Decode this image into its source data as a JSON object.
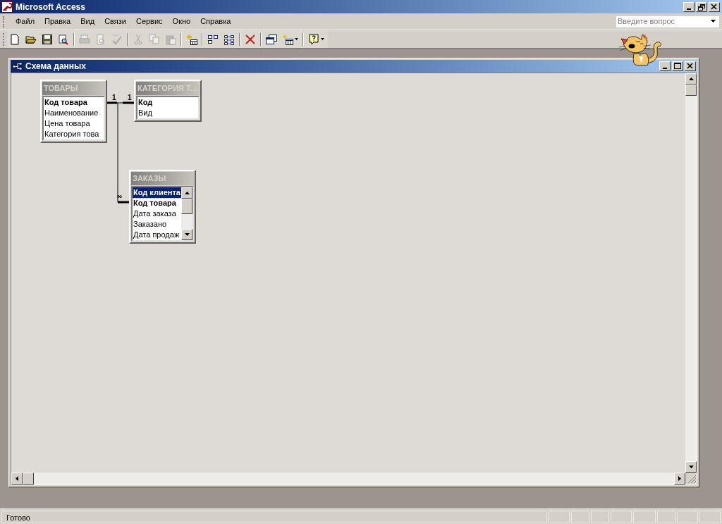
{
  "window": {
    "title": "Microsoft Access"
  },
  "menu": [
    "Файл",
    "Правка",
    "Вид",
    "Связи",
    "Сервис",
    "Окно",
    "Справка"
  ],
  "help_search": {
    "placeholder": "Введите вопрос"
  },
  "toolbar": [
    {
      "kind": "new",
      "disabled": false
    },
    {
      "kind": "open",
      "disabled": false
    },
    {
      "kind": "save",
      "disabled": false
    },
    {
      "kind": "search",
      "disabled": false
    },
    {
      "kind": "separator"
    },
    {
      "kind": "print",
      "disabled": true
    },
    {
      "kind": "preview",
      "disabled": true
    },
    {
      "kind": "spelling",
      "disabled": true
    },
    {
      "kind": "separator"
    },
    {
      "kind": "cut",
      "disabled": true
    },
    {
      "kind": "copy",
      "disabled": true
    },
    {
      "kind": "paste",
      "disabled": true
    },
    {
      "kind": "separator"
    },
    {
      "kind": "show-table",
      "disabled": false
    },
    {
      "kind": "separator"
    },
    {
      "kind": "direct",
      "disabled": false
    },
    {
      "kind": "all",
      "disabled": false
    },
    {
      "kind": "separator"
    },
    {
      "kind": "delete",
      "disabled": false
    },
    {
      "kind": "separator"
    },
    {
      "kind": "database-window",
      "disabled": false
    },
    {
      "kind": "new-object",
      "disabled": false
    },
    {
      "kind": "separator"
    },
    {
      "kind": "help",
      "disabled": false
    }
  ],
  "diagram_window": {
    "title": "Схема данных",
    "tables": [
      {
        "name": "ТОВАРЫ",
        "scrollbar": false,
        "fields": [
          {
            "name": "Код товара",
            "key": true,
            "selected": false
          },
          {
            "name": "Наименование",
            "key": false,
            "selected": false
          },
          {
            "name": "Цена товара",
            "key": false,
            "selected": false
          },
          {
            "name": "Категория това",
            "key": false,
            "selected": false
          }
        ]
      },
      {
        "name": "КАТЕГОРИЯ Т...",
        "scrollbar": false,
        "fields": [
          {
            "name": "Код",
            "key": true,
            "selected": false
          },
          {
            "name": "Вид",
            "key": false,
            "selected": false
          }
        ]
      },
      {
        "name": "ЗАКАЗЫ",
        "scrollbar": true,
        "fields": [
          {
            "name": "Код клиента",
            "key": true,
            "selected": true
          },
          {
            "name": "Код товара",
            "key": true,
            "selected": false
          },
          {
            "name": "Дата заказа",
            "key": false,
            "selected": false
          },
          {
            "name": "Заказано",
            "key": false,
            "selected": false
          },
          {
            "name": "Дата продаж",
            "key": false,
            "selected": false
          }
        ]
      }
    ],
    "relationships": [
      {
        "from_end": "1",
        "to_end": "1"
      },
      {
        "to_end": "∞"
      }
    ]
  },
  "status_bar": {
    "text": "Готово"
  }
}
